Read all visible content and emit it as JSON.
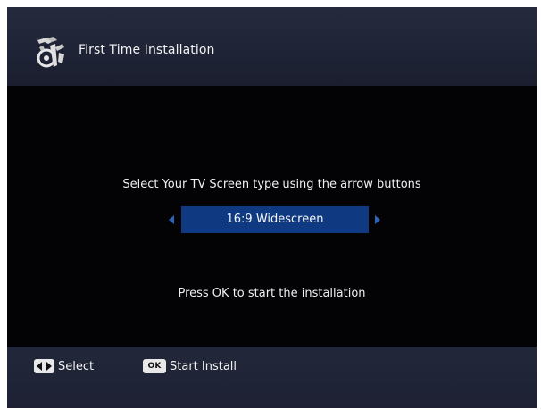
{
  "header": {
    "title": "First Time Installation",
    "icon": "installation-tools-icon"
  },
  "main": {
    "instruction": "Select Your TV Screen type using the arrow buttons",
    "screen_type": {
      "selected": "16:9 Widescreen",
      "left_arrow_icon": "arrow-left-icon",
      "right_arrow_icon": "arrow-right-icon"
    },
    "hint": "Press OK to start the installation"
  },
  "footer": {
    "select": {
      "icon": "left-right-keys-icon",
      "label": "Select"
    },
    "start_install": {
      "key_label": "OK",
      "label": "Start Install"
    }
  },
  "colors": {
    "background": "#050507",
    "header_bar": "#22273a",
    "selection_box": "#0f3a82",
    "arrow": "#2f63b5",
    "text": "#f0f0f0"
  }
}
